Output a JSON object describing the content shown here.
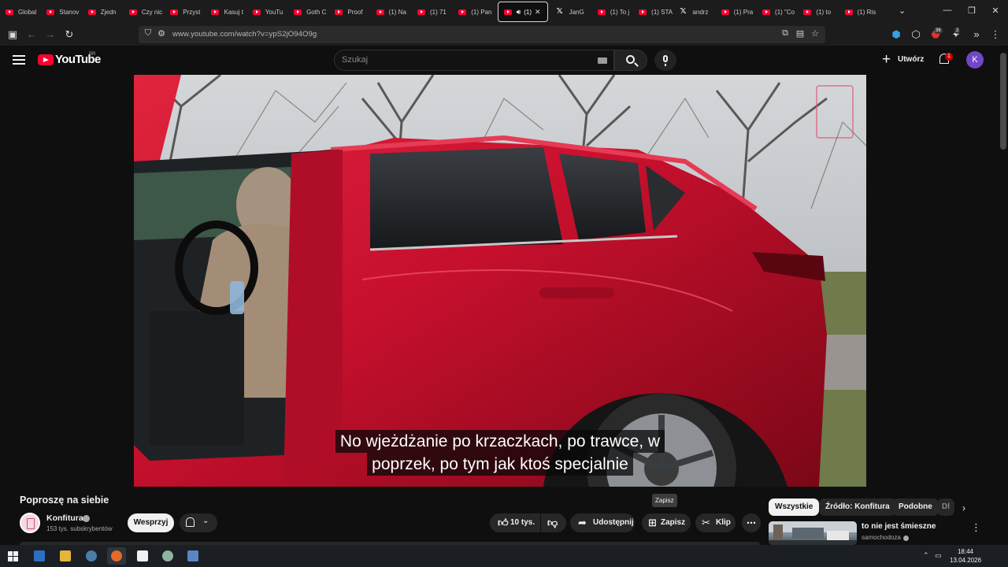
{
  "browser": {
    "tabs": [
      {
        "label": "Global",
        "icon": "youtube-icon"
      },
      {
        "label": "Stanov",
        "icon": "youtube-icon"
      },
      {
        "label": "Zjedn",
        "icon": "youtube-icon"
      },
      {
        "label": "Czy nic",
        "icon": "youtube-icon"
      },
      {
        "label": "Przyst",
        "icon": "youtube-icon"
      },
      {
        "label": "Kasuj t",
        "icon": "youtube-icon"
      },
      {
        "label": "YouTu",
        "icon": "youtube-icon"
      },
      {
        "label": "Goth C",
        "icon": "youtube-icon"
      },
      {
        "label": "Proof",
        "icon": "youtube-icon"
      },
      {
        "label": "(1) Na",
        "icon": "youtube-icon"
      },
      {
        "label": "(1) 71",
        "icon": "youtube-icon"
      },
      {
        "label": "(1) Pan",
        "icon": "youtube-icon"
      },
      {
        "label": "(1)",
        "icon": "youtube-icon",
        "active": true
      },
      {
        "label": "JanG",
        "icon": "x-icon"
      },
      {
        "label": "(1) To j",
        "icon": "youtube-icon"
      },
      {
        "label": "(1) STA",
        "icon": "youtube-icon"
      },
      {
        "label": "andrz",
        "icon": "x-icon"
      },
      {
        "label": "(1) Pra",
        "icon": "youtube-icon"
      },
      {
        "label": "(1) \"Co",
        "icon": "youtube-icon"
      },
      {
        "label": "(1) to",
        "icon": "youtube-icon"
      },
      {
        "label": "(1) Ris",
        "icon": "youtube-icon"
      }
    ],
    "url": "www.youtube.com/watch?v=ypS2jO94O9g",
    "extension_badges": [
      "36",
      "2"
    ]
  },
  "youtube": {
    "wordmark": "YouTube",
    "region": "BR",
    "search_placeholder": "Szukaj",
    "create_label": "Utwórz",
    "notifications_count": "1",
    "avatar_letter": "K"
  },
  "video": {
    "subtitle_line1": "No wjeżdżanie po krzaczkach, po trawce, w",
    "subtitle_line2": "poprzek, po tym jak ktoś specjalnie"
  },
  "watch": {
    "title": "Poproszę na siebie",
    "channel_name": "Konfitura",
    "channel_subs": "153 tys. subskrybentów",
    "join_label": "Wesprzyj",
    "like_count": "10 tys.",
    "share_label": "Udostępnij",
    "save_label": "Zapisz",
    "clip_label": "Klip",
    "tooltip": "Zapisz"
  },
  "chips": {
    "all": "Wszystkie",
    "source": "Źródło: Konfitura",
    "similar": "Podobne",
    "more": "Dl"
  },
  "recommendation": {
    "title": "to nie jest śmieszne",
    "channel": "samochodoza"
  },
  "taskbar": {
    "time": "18:44",
    "date": "13.04.2026"
  },
  "colors": {
    "background": "#0f0f0f",
    "youtube_red": "#ff0033",
    "car_red": "#c8102e",
    "avatar": "#7048c6"
  }
}
